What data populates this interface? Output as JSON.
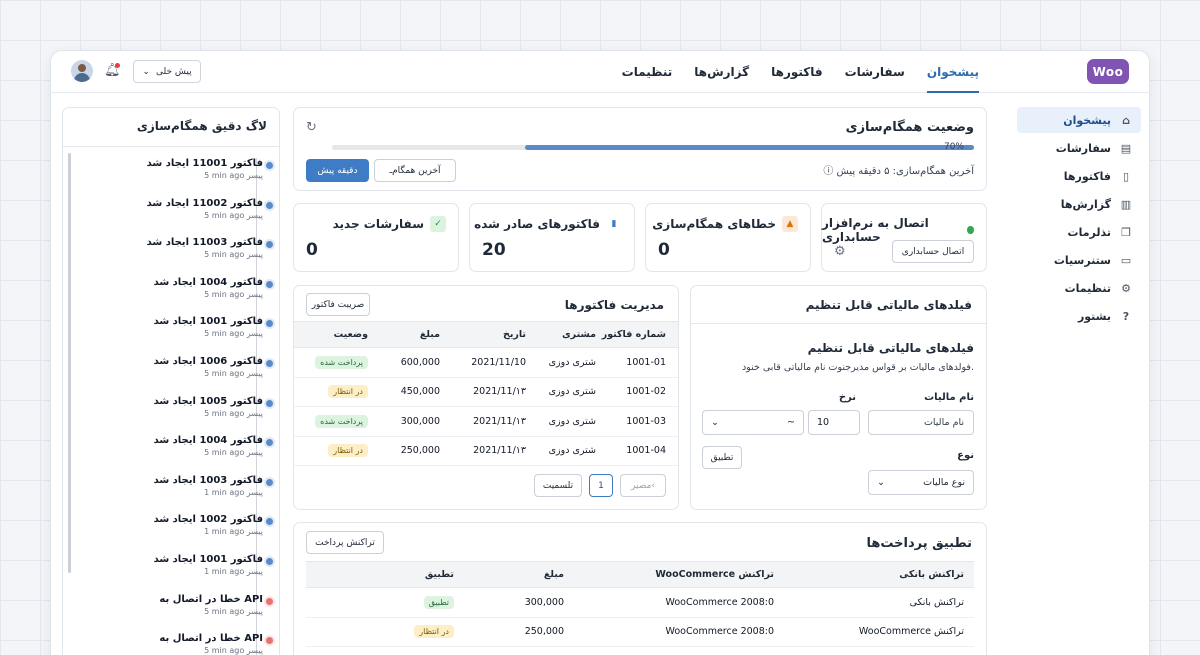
{
  "brand": {
    "logo": "Woo"
  },
  "nav": {
    "items": [
      "پیشخوان",
      "سفارشات",
      "فاکتورها",
      "گزارش‌ها",
      "تنظیمات"
    ],
    "active": 0
  },
  "header": {
    "workspace_dropdown": "پیش خلی",
    "avatar": "user-avatar",
    "bell": "bell-icon"
  },
  "sidebar": {
    "items": [
      {
        "label": "پیشخوان",
        "icon": "home-icon"
      },
      {
        "label": "سفارشات",
        "icon": "orders-icon"
      },
      {
        "label": "فاکتورها",
        "icon": "invoice-icon"
      },
      {
        "label": "گزارش‌ها",
        "icon": "chart-icon"
      },
      {
        "label": "تذلرمات",
        "icon": "reminders-icon"
      },
      {
        "label": "ستنرسیات",
        "icon": "card-icon"
      },
      {
        "label": "تنظیمات",
        "icon": "gear-icon"
      },
      {
        "label": "بشتور",
        "icon": "help-icon"
      }
    ]
  },
  "sync_status": {
    "title": "وضعیت همگام‌سازی",
    "progress": 0.7,
    "progress_label": "70%",
    "last_sync": "آخرین همگام‌سازی: ۵ دقیقه پیش",
    "btn_last": "آخرین همگام‌ـ",
    "btn_ago": "دقیقه پیش"
  },
  "stats": [
    {
      "title": "اتصال به نرم‌افزار حسابداری",
      "button": "اتصال حسابداری"
    },
    {
      "title": "خطاهای همگام‌سازی",
      "value": "0"
    },
    {
      "title": "فاکتورهای صادر شده",
      "value": "20"
    },
    {
      "title": "سفارشات جدید",
      "value": "0"
    }
  ],
  "sync_log": {
    "title": "لاگ دقیق همگام‌سازی",
    "items": [
      {
        "title": "فاکتور 11001 ایجاد شد",
        "sub": "5 min ago پیسر",
        "type": "ok"
      },
      {
        "title": "فاکتور 11002 ایجاد شد",
        "sub": "5 min ago پیسر",
        "type": "ok"
      },
      {
        "title": "فاکتور 11003 ایجاد شد",
        "sub": "5 min ago پیسر",
        "type": "ok"
      },
      {
        "title": "فاکتور 1004 ایجاد شد",
        "sub": "5 min ago پیسر",
        "type": "ok"
      },
      {
        "title": "فاکتور 1001 ایجاد شد",
        "sub": "5 min ago پیسر",
        "type": "ok"
      },
      {
        "title": "فاکتور 1006 ایجاد شد",
        "sub": "5 min ago پیسر",
        "type": "ok"
      },
      {
        "title": "فاکتور 1005 ایجاد شد",
        "sub": "5 min ago پیسر",
        "type": "ok"
      },
      {
        "title": "فاکتور 1004 ایجاد شد",
        "sub": "5 min ago پیسر",
        "type": "ok"
      },
      {
        "title": "فاکتور 1003 ایجاد شد",
        "sub": "1 min ago پیسر",
        "type": "ok"
      },
      {
        "title": "فاکتور 1002 ایجاد شد",
        "sub": "1 min ago پیسر",
        "type": "ok"
      },
      {
        "title": "فاکتور 1001 ایجاد شد",
        "sub": "1 min ago پیسر",
        "type": "ok"
      },
      {
        "title": "خطا در اتصال به API",
        "sub": "5 min ago پیسر",
        "type": "err"
      },
      {
        "title": "خطا در اتصال به API",
        "sub": "5 min ago پیسر",
        "type": "err"
      }
    ]
  },
  "tax": {
    "header": "فیلدهای مالیاتی قابل تنظیم",
    "title": "فیلدهای مالیاتی قابل تنظیم",
    "desc": "فولدهای مالیات بر قواس مدیرجنوت نام مالیاتی قابی خنود.",
    "name_label": "نام مالیات",
    "name_placeholder": "نام مالیات",
    "rate_label": "نرخ",
    "rate_value": "10",
    "select_value": "~",
    "apply": "تطبیق",
    "type_label": "نوع",
    "type_placeholder": "نوع مالیات"
  },
  "invoices": {
    "title": "مدیریت فاکتورها",
    "manage_btn": "صریبت فاکتور",
    "columns": [
      "شماره فاکتور",
      "مشتری",
      "تاریخ",
      "مبلغ",
      "وضعیت"
    ],
    "rows": [
      {
        "no": "1001-01",
        "customer": "شتری دوزی",
        "date": "2021/11/10",
        "amount": "600,000",
        "status": "پرداخت شده",
        "kind": "paid"
      },
      {
        "no": "1001-02",
        "customer": "شتری دوزی",
        "date": "2021/11/۱۳",
        "amount": "450,000",
        "status": "در انتظار",
        "kind": "pending"
      },
      {
        "no": "1001-03",
        "customer": "شتری دوزی",
        "date": "2021/11/۱۳",
        "amount": "300,000",
        "status": "پرداخت شده",
        "kind": "paid"
      },
      {
        "no": "1001-04",
        "customer": "شتری دوزی",
        "date": "2021/11/۱۳",
        "amount": "250,000",
        "status": "در انتظار",
        "kind": "pending"
      }
    ],
    "pager": {
      "prev": "مصیر‹",
      "page": "1",
      "next": "تلسمیت"
    }
  },
  "payments": {
    "title": "تطبیق پرداخت‌ها",
    "btn": "تراکنش پرداخت",
    "columns": [
      "تراکنش بانکی",
      "تراکنش WooCommerce",
      "مبلغ",
      "تطبیق"
    ],
    "rows": [
      {
        "bank": "تراکنش بانکی",
        "woo": "WooCommerce 2008:0",
        "amount": "300,000",
        "status": "تطبیق",
        "kind": "paid"
      },
      {
        "bank": "تراکنش WooCommerce",
        "woo": "WooCommerce 2008:0",
        "amount": "250,000",
        "status": "در انتظار",
        "kind": "pending"
      }
    ]
  }
}
